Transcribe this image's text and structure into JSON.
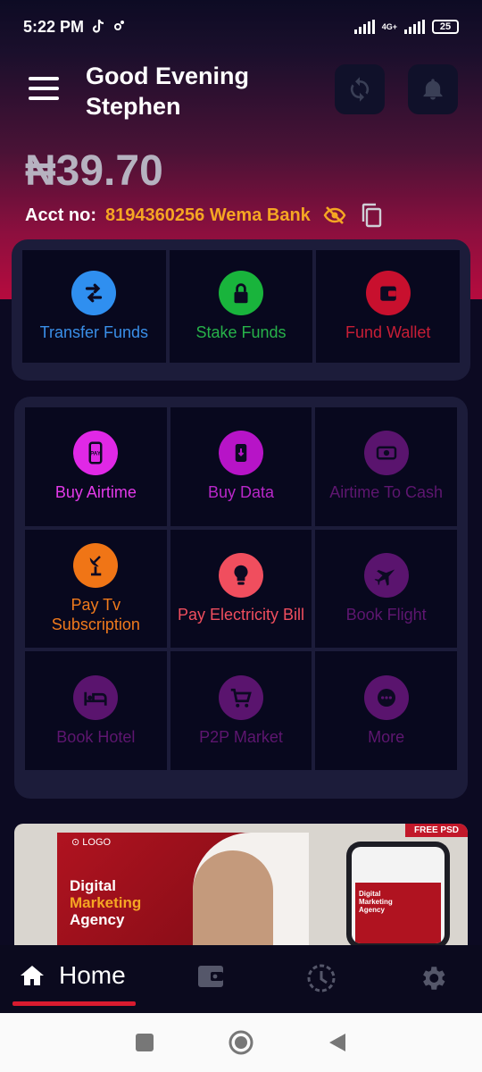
{
  "status_bar": {
    "time": "5:22 PM",
    "network": "4G+",
    "battery": "25"
  },
  "header": {
    "greeting": "Good Evening",
    "name": "Stephen",
    "balance": "₦39.70",
    "acct_label": "Acct no:",
    "acct_number": "8194360256 Wema Bank"
  },
  "primary_actions": [
    {
      "label": "Transfer Funds",
      "icon": "transfer-icon",
      "color": "#2f8ff0",
      "text_color": "#3a8fe8"
    },
    {
      "label": "Stake Funds",
      "icon": "lock-icon",
      "color": "#19b43c",
      "text_color": "#27b24a"
    },
    {
      "label": "Fund Wallet",
      "icon": "wallet-icon",
      "color": "#c8102e",
      "text_color": "#c81e36"
    }
  ],
  "services": [
    {
      "label": "Buy Airtime",
      "icon": "airtime-icon",
      "color": "#e028e6",
      "text_color": "#e33ae9"
    },
    {
      "label": "Buy Data",
      "icon": "data-icon",
      "color": "#b714c7",
      "text_color": "#b927c9"
    },
    {
      "label": "Airtime To Cash",
      "icon": "cash-icon",
      "color": "#5a146e",
      "text_color": "#5e1670"
    },
    {
      "label": "Pay Tv Subscription",
      "icon": "satellite-icon",
      "color": "#f07516",
      "text_color": "#f07a1c"
    },
    {
      "label": "Pay Electricity Bill",
      "icon": "bulb-icon",
      "color": "#f04e5e",
      "text_color": "#f04e5e"
    },
    {
      "label": "Book Flight",
      "icon": "plane-icon",
      "color": "#5a146e",
      "text_color": "#5e1670"
    },
    {
      "label": "Book Hotel",
      "icon": "bed-icon",
      "color": "#5a146e",
      "text_color": "#5e1670"
    },
    {
      "label": "P2P Market",
      "icon": "cart-icon",
      "color": "#5a146e",
      "text_color": "#5e1670"
    },
    {
      "label": "More",
      "icon": "more-icon",
      "color": "#5a146e",
      "text_color": "#5e1670"
    }
  ],
  "banner": {
    "logo": "⊙ LOGO",
    "title_line1": "Digital",
    "title_line2": "Marketing",
    "title_line3": "Agency",
    "tag": "FREE PSD"
  },
  "bottom_nav": {
    "home_label": "Home"
  }
}
